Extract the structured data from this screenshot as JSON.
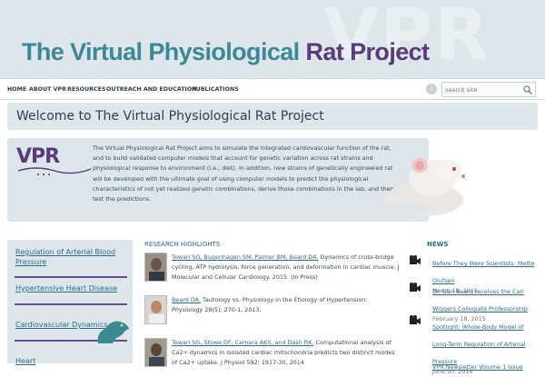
{
  "header": {
    "watermark": "VPR",
    "title_part1": "The Virtual Physiological ",
    "title_part2": "Rat Project"
  },
  "nav": {
    "items": [
      "HOME",
      "ABOUT VPR",
      "RESOURCES",
      "OUTREACH AND EDUCATION",
      "PUBLICATIONS"
    ],
    "search_placeholder": "search site",
    "rss_icon": "rss-icon",
    "search_icon": "search-icon"
  },
  "welcome": {
    "title": "Welcome to The Virtual Physiological Rat Project"
  },
  "intro": {
    "logo_text": "VPR",
    "text": "The Virtual Physiological Rat Project aims to simulate the integrated cardiovascular function of the rat, and to build validated computer models that account for genetic variation across rat strains and physiological response to environment (i.e., diet). In addition, new strains of genetically engineered rat will be developed with the ultimate goal of using computer models to predict the physiological characteristics of not yet realized genetic combinations, derive those combinations in the lab, and then test the predictions."
  },
  "sidebar": {
    "items": [
      "Regulation of Arterial Blood Pressure",
      "Hypertensive Heart Disease",
      "Cardiovascular Dynamics",
      "Heart"
    ]
  },
  "research": {
    "heading": "RESEARCH HIGHLIGHTS",
    "items": [
      {
        "authors": "Tewari SG, Bugenhagen SM, Palmer BM, Beard DA.",
        "text": " Dynamics of cross-bridge cycling, ATP hydrolysis, force generation, and deformation in cardiac muscle. J Molecular and Cellular Cardiology. 2015. (In Press)",
        "journal": ""
      },
      {
        "authors": "Beard DA.",
        "text": " Tautology vs. Physiology in the Etiology of Hypertension.",
        "journal": "Physiology",
        "tail": " 28(5): 270-1, 2013."
      },
      {
        "authors": "Tewari SG, Stowe DF, Camara AKS, and Dash RK.",
        "text": " Computational analysis of Ca2+ dynamics in isolated cardiac mitochondria predicts two distinct modes of Ca2+ uptake. J Physiol 592: 1917-30, 2014",
        "journal": ""
      }
    ]
  },
  "news": {
    "heading": "NEWS",
    "items": [
      {
        "title": "Before They Were Scientists: Mette Olufsen",
        "date": "March 19, 2015"
      },
      {
        "title": "Dr. Dan Beard receives the Carl Wiggers Collegiate Professorship",
        "date": "February 18, 2015"
      },
      {
        "title": "Spotlight: Whole-Body Model of Long-Term Regulation of Arterial Pressure",
        "date": "June 30, 2014"
      },
      {
        "title": "VPR Newsletter Volume 1 Issue",
        "date": ""
      }
    ]
  },
  "colors": {
    "brand_teal": "#3d8796",
    "brand_purple": "#5a3a78",
    "panel_bg": "#dde6ea",
    "link": "#2e6b8c"
  }
}
